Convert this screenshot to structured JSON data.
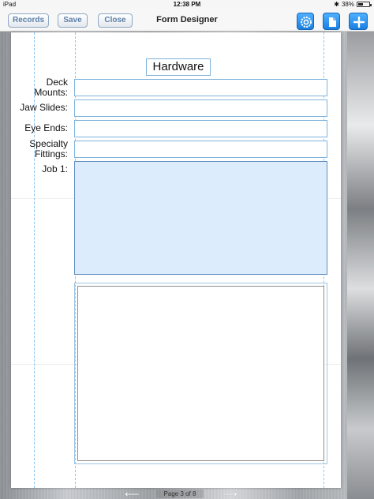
{
  "status_bar": {
    "carrier": "iPad",
    "time": "12:38 PM",
    "battery": "38%",
    "battery_level": 0.38,
    "bluetooth_icon": "bluetooth-icon"
  },
  "toolbar": {
    "title": "Form Designer",
    "buttons": {
      "records": "Records",
      "save": "Save",
      "close": "Close"
    },
    "icons": [
      "gear-icon",
      "new-document-icon",
      "plus-icon"
    ],
    "accent": "#1a7fe0"
  },
  "form": {
    "header": "Hardware",
    "fields": [
      {
        "label": "Deck Mounts:"
      },
      {
        "label": "Jaw Slides:"
      },
      {
        "label": "Eye Ends:"
      },
      {
        "label": "Specialty Fittings:"
      },
      {
        "label": "Job 1:"
      }
    ]
  },
  "pager": {
    "indicator": "Page 3 of 8",
    "prev_icon": "arrow-left-icon",
    "next_icon": "arrow-right-icon"
  }
}
